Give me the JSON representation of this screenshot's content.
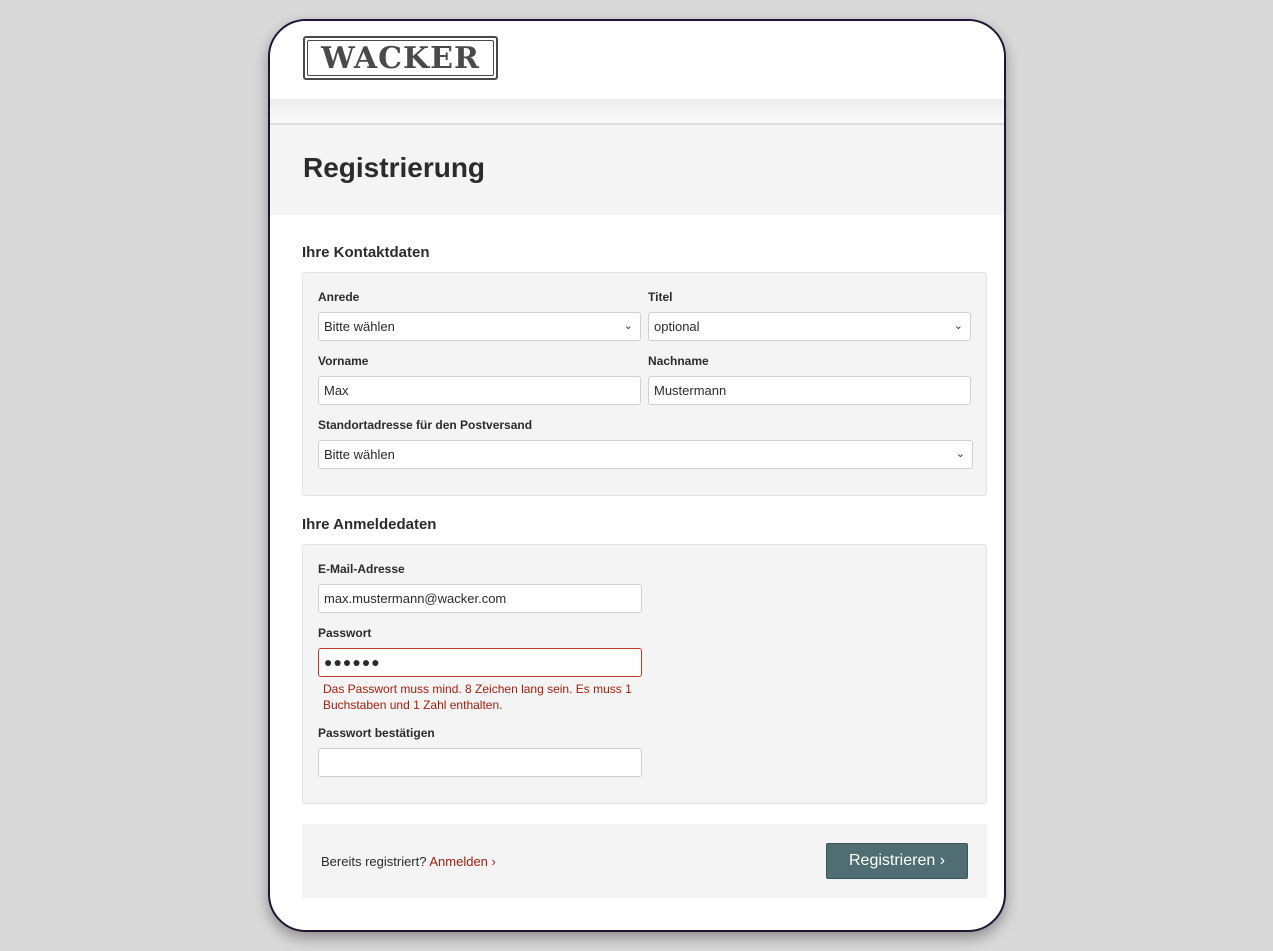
{
  "header": {
    "logo_text": "WACKER"
  },
  "page": {
    "title": "Registrierung"
  },
  "contact": {
    "section_title": "Ihre Kontaktdaten",
    "salutation": {
      "label": "Anrede",
      "value": "Bitte wählen"
    },
    "title": {
      "label": "Titel",
      "value": "optional"
    },
    "first_name": {
      "label": "Vorname",
      "value": "Max"
    },
    "last_name": {
      "label": "Nachname",
      "value": "Mustermann"
    },
    "address": {
      "label": "Standortadresse für den Postversand",
      "value": "Bitte wählen"
    }
  },
  "login": {
    "section_title": "Ihre Anmeldedaten",
    "email": {
      "label": "E-Mail-Adresse",
      "value": "max.mustermann@wacker.com"
    },
    "password": {
      "label": "Passwort",
      "value": "●●●●●●",
      "error": "Das Passwort muss mind. 8 Zeichen lang sein. Es muss 1 Buchstaben und 1 Zahl enthalten."
    },
    "password_confirm": {
      "label": "Passwort bestätigen",
      "value": ""
    }
  },
  "footer": {
    "already_text": "Bereits registriert? ",
    "login_link": "Anmelden ›",
    "register_button": "Registrieren ›"
  },
  "icons": {
    "select_chevron": "⌄"
  },
  "colors": {
    "accent_button": "#4f6d72",
    "error": "#a3200e"
  }
}
